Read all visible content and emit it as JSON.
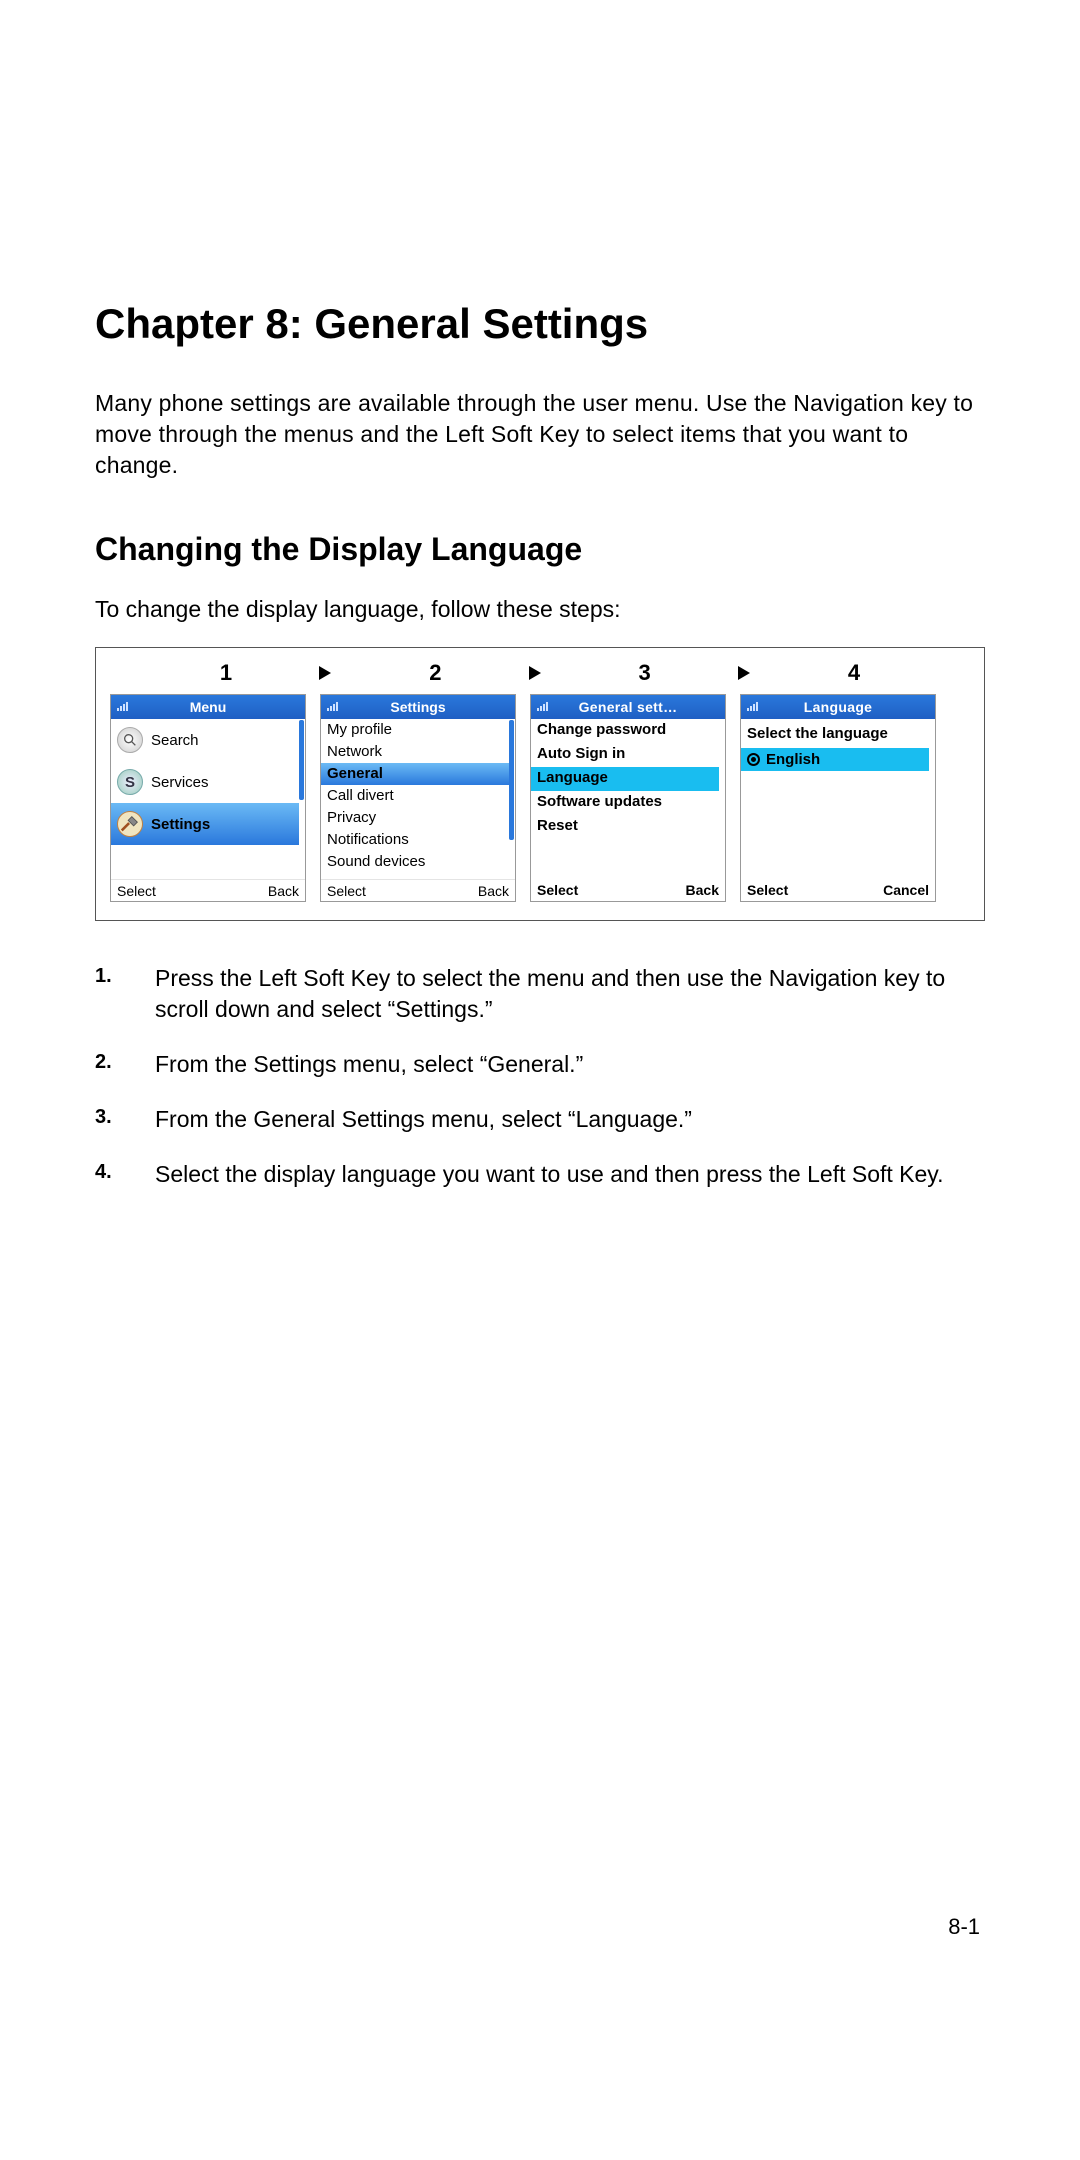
{
  "chapter_title": "Chapter 8: General Settings",
  "intro": "Many phone settings are available through the user menu. Use the Navigation key to move through the menus and the Left Soft Key to select items that you want to change.",
  "section_title": "Changing the Display Language",
  "section_lead": "To change the display language, follow these steps:",
  "figure": {
    "step_numbers": [
      "1",
      "2",
      "3",
      "4"
    ],
    "screens": [
      {
        "title": "Menu",
        "soft_left": "Select",
        "soft_right": "Back",
        "rows": [
          {
            "icon": "search",
            "label": "Search",
            "selected": false
          },
          {
            "icon": "services",
            "label": "Services",
            "selected": false
          },
          {
            "icon": "settings",
            "label": "Settings",
            "selected": true
          }
        ],
        "scroll_height": 80
      },
      {
        "title": "Settings",
        "soft_left": "Select",
        "soft_right": "Back",
        "rows": [
          {
            "label": "My profile",
            "selected": false
          },
          {
            "label": "Network",
            "selected": false
          },
          {
            "label": "General",
            "selected": true
          },
          {
            "label": "Call divert",
            "selected": false
          },
          {
            "label": "Privacy",
            "selected": false
          },
          {
            "label": "Notifications",
            "selected": false
          },
          {
            "label": "Sound devices",
            "selected": false
          }
        ],
        "scroll_height": 120
      },
      {
        "title": "General sett…",
        "soft_left": "Select",
        "soft_right": "Back",
        "rows": [
          {
            "label": "Change password",
            "selected": false
          },
          {
            "label": "Auto Sign in",
            "selected": false
          },
          {
            "label": "Language",
            "selected": true
          },
          {
            "label": "Software updates",
            "selected": false
          },
          {
            "label": "Reset",
            "selected": false
          }
        ]
      },
      {
        "title": "Language",
        "subtitle": "Select the language",
        "soft_left": "Select",
        "soft_right": "Cancel",
        "options": [
          {
            "label": "English",
            "selected": true
          }
        ]
      }
    ]
  },
  "steps": [
    {
      "n": "1.",
      "text": "Press the Left Soft Key to select the menu and then use the Navigation key to scroll down and select “Settings.”"
    },
    {
      "n": "2.",
      "text": "From the Settings menu, select “General.”"
    },
    {
      "n": "3.",
      "text": "From the General Settings menu, select “Language.”"
    },
    {
      "n": "4.",
      "text": "Select the display language you want to use and then press the Left Soft Key."
    }
  ],
  "page_number": "8-1"
}
